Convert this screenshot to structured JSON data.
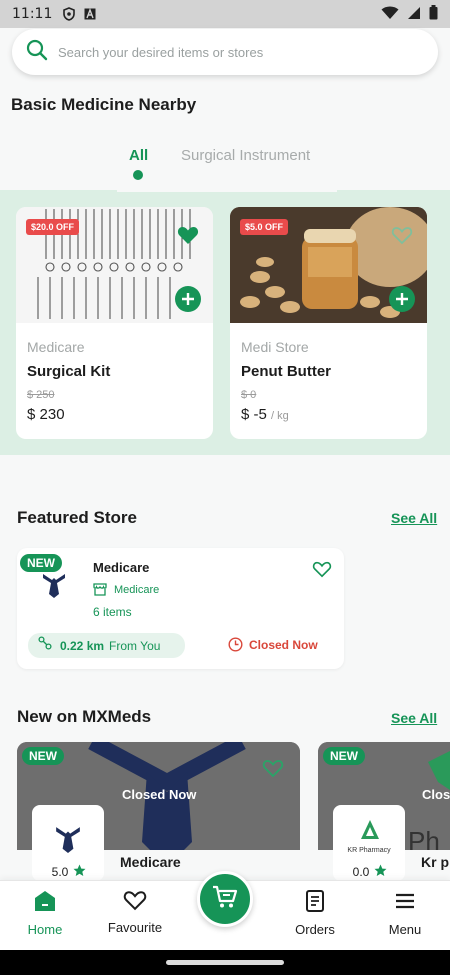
{
  "status_bar": {
    "time": "11:11"
  },
  "search": {
    "placeholder": "Search your desired items or stores"
  },
  "basic_medicine": {
    "title": "Basic Medicine Nearby",
    "tabs": [
      {
        "label": "All",
        "active": true
      },
      {
        "label": "Surgical Instrument",
        "active": false
      }
    ],
    "products": [
      {
        "badge": "$20.0 OFF",
        "store": "Medicare",
        "name": "Surgical Kit",
        "old_price": "$ 250",
        "price": "$ 230",
        "unit": "",
        "image_icon": "surgical-instruments-image"
      },
      {
        "badge": "$5.0 OFF",
        "store": "Medi Store",
        "name": "Penut Butter",
        "old_price": "$ 0",
        "price": "$ -5",
        "unit": "/ kg",
        "image_icon": "peanut-butter-image"
      }
    ]
  },
  "featured_store": {
    "title": "Featured Store",
    "see_all": "See All",
    "store": {
      "badge": "NEW",
      "name": "Medicare",
      "category": "Medicare",
      "items": "6 items",
      "distance": "0.22 km",
      "distance_suffix": "From You",
      "status": "Closed Now"
    }
  },
  "new_on": {
    "title": "New on MXMeds",
    "see_all": "See All",
    "stores": [
      {
        "badge": "NEW",
        "status": "Closed Now",
        "name": "Medicare",
        "rating": "5.0"
      },
      {
        "badge": "NEW",
        "status": "Clos",
        "name": "Kr p",
        "rating": "0.0",
        "logo_text": "KR Pharmacy",
        "bg_text": "Ph"
      }
    ]
  },
  "bottom_nav": {
    "home": "Home",
    "favourite": "Favourite",
    "orders": "Orders",
    "menu": "Menu"
  },
  "colors": {
    "brand_green": "#169457",
    "danger_red": "#e94b4b",
    "tab_band": "#dcefe4"
  }
}
